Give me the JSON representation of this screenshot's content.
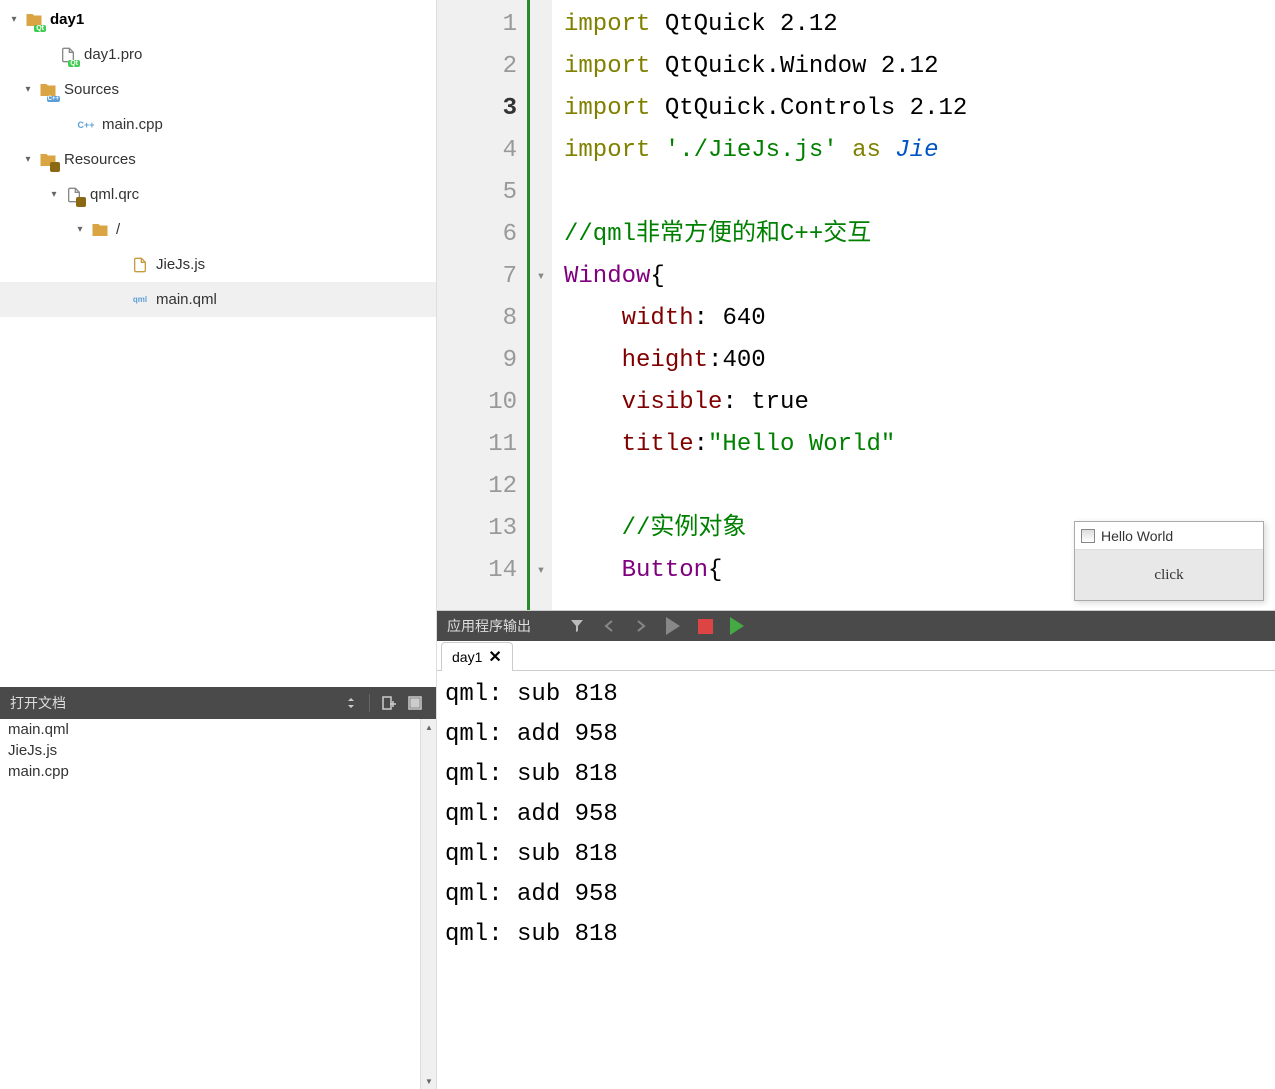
{
  "tree": {
    "project": "day1",
    "proFile": "day1.pro",
    "sources": "Sources",
    "mainCpp": "main.cpp",
    "resources": "Resources",
    "qrc": "qml.qrc",
    "slash": "/",
    "jieJs": "JieJs.js",
    "mainQml": "main.qml"
  },
  "openDocs": {
    "title": "打开文档",
    "items": [
      "main.qml",
      "JieJs.js",
      "main.cpp"
    ]
  },
  "editor": {
    "lines": [
      {
        "n": "1",
        "tokens": [
          {
            "t": "import",
            "c": "kw"
          },
          {
            "t": " QtQuick 2.12"
          }
        ]
      },
      {
        "n": "2",
        "tokens": [
          {
            "t": "import",
            "c": "kw"
          },
          {
            "t": " QtQuick.Window 2.12"
          }
        ]
      },
      {
        "n": "3",
        "current": true,
        "tokens": [
          {
            "t": "import",
            "c": "kw"
          },
          {
            "t": " QtQuick.Controls 2.12"
          }
        ]
      },
      {
        "n": "4",
        "tokens": [
          {
            "t": "import",
            "c": "kw"
          },
          {
            "t": " "
          },
          {
            "t": "'./JieJs.js'",
            "c": "str"
          },
          {
            "t": " "
          },
          {
            "t": "as",
            "c": "as"
          },
          {
            "t": " "
          },
          {
            "t": "Jie",
            "c": "alias"
          }
        ]
      },
      {
        "n": "5",
        "tokens": []
      },
      {
        "n": "6",
        "tokens": [
          {
            "t": "//qml非常方便的和C++交互",
            "c": "cmt"
          }
        ]
      },
      {
        "n": "7",
        "fold": true,
        "tokens": [
          {
            "t": "Window",
            "c": "type"
          },
          {
            "t": "{"
          }
        ]
      },
      {
        "n": "8",
        "tokens": [
          {
            "t": "    "
          },
          {
            "t": "width",
            "c": "prop"
          },
          {
            "t": ": "
          },
          {
            "t": "640"
          }
        ]
      },
      {
        "n": "9",
        "tokens": [
          {
            "t": "    "
          },
          {
            "t": "height",
            "c": "prop"
          },
          {
            "t": ":"
          },
          {
            "t": "400"
          }
        ]
      },
      {
        "n": "10",
        "tokens": [
          {
            "t": "    "
          },
          {
            "t": "visible",
            "c": "prop"
          },
          {
            "t": ": true"
          }
        ]
      },
      {
        "n": "11",
        "tokens": [
          {
            "t": "    "
          },
          {
            "t": "title",
            "c": "prop"
          },
          {
            "t": ":"
          },
          {
            "t": "\"Hello World\"",
            "c": "str"
          }
        ]
      },
      {
        "n": "12",
        "tokens": []
      },
      {
        "n": "13",
        "tokens": [
          {
            "t": "    "
          },
          {
            "t": "//实例对象",
            "c": "cmt"
          }
        ]
      },
      {
        "n": "14",
        "fold": true,
        "tokens": [
          {
            "t": "    "
          },
          {
            "t": "Button",
            "c": "type"
          },
          {
            "t": "{"
          }
        ]
      }
    ]
  },
  "output": {
    "headerTitle": "应用程序输出",
    "tabName": "day1",
    "lines": [
      "qml: sub 818",
      "qml: add 958",
      "qml: sub 818",
      "qml: add 958",
      "qml: sub 818",
      "qml: add 958",
      "qml: sub 818"
    ]
  },
  "appWin": {
    "title": "Hello World",
    "button": "click"
  }
}
